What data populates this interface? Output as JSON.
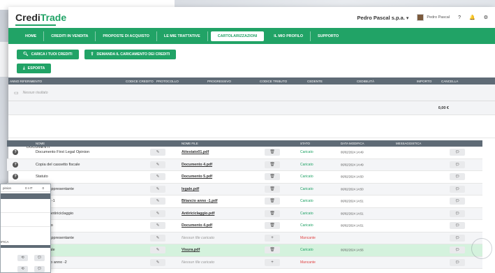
{
  "header": {
    "logo_part1": "Credi",
    "logo_part2": "Trade",
    "company": "Pedro Pascal s.p.a.",
    "company_caret": "▾",
    "user_name": "Pedro Pascal",
    "help": "?",
    "bell": "🔔",
    "settings": "⚙"
  },
  "nav": {
    "items": [
      "HOME",
      "CREDITI IN VENDITA",
      "PROPOSTE DI ACQUISTO",
      "LE MIE TRATTATIVE",
      "CARTOLARIZZAZIONI",
      "IL MIO PROFILO",
      "SUPPORTO"
    ],
    "active_index": 4
  },
  "actions": {
    "upload_label": "CARICA I TUOI CREDITI",
    "delegate_label": "DEMANDA IL CARICAMENTO DEI CREDITI",
    "export_label": "ESPORTA"
  },
  "credits_table": {
    "headers": [
      "ANNO RIFERIMENTO",
      "CODICE CREDITO",
      "PROTOCOLLO",
      "PROGRESSIVO",
      "CODICE TRIBUTO",
      "CEDENTE",
      "CEDIBILITÀ",
      "IMPORTO",
      "CANCELLA"
    ],
    "empty_text": "Nessun risultato",
    "total": "0,00 €"
  },
  "documents": {
    "section_title": "DOCUMENTI",
    "headers": [
      "NOME",
      "NOME FILE",
      "STATO",
      "DATA MODIFICA",
      "MESSAGGISTICA"
    ],
    "rows": [
      {
        "name": "Documento First Legal Opinion",
        "file": "Attestato01.pdf",
        "status": "Caricato",
        "date": "06/02/2024 14:49",
        "has_file": true
      },
      {
        "name": "Copia del cassetto fiscale",
        "file": "Documento 4.pdf",
        "status": "Caricato",
        "date": "06/02/2024 14:49",
        "has_file": true
      },
      {
        "name": "Statuto",
        "file": "Documento 5.pdf",
        "status": "Caricato",
        "date": "06/02/2024 14:50",
        "has_file": true
      },
      {
        "name": "egale Rappresentante",
        "file": "legale.pdf",
        "status": "Caricato",
        "date": "06/02/2024 14:50",
        "has_file": true
      },
      {
        "name": "cio anno -1",
        "file": "Bilancio anno -1.pdf",
        "status": "Caricato",
        "date": "06/02/2024 14:51",
        "has_file": true
      },
      {
        "name": "tionario Antiriciclaggio",
        "file": "Antiriciclaggio.pdf",
        "status": "Caricato",
        "date": "06/02/2024 14:51",
        "has_file": true
      },
      {
        "name": "costitutivo",
        "file": "Documento 4.pdf",
        "status": "Caricato",
        "date": "06/02/2024 14:51",
        "has_file": true
      },
      {
        "name": "egale Rappresentante",
        "file": "Nessun file caricato",
        "status": "Mancante",
        "date": "",
        "has_file": false
      },
      {
        "name": "a camerale",
        "file": "Visura.pdf",
        "status": "Caricato",
        "date": "06/02/2024 14:56",
        "has_file": true
      },
      {
        "name": "o Bilancio anno -2",
        "file": "Nessun file caricato",
        "status": "Mancante",
        "date": "",
        "has_file": false
      }
    ]
  },
  "overlay": {
    "col1": "pinion",
    "col2": "0 I-IT",
    "col3": "0",
    "label": "IFICA"
  }
}
